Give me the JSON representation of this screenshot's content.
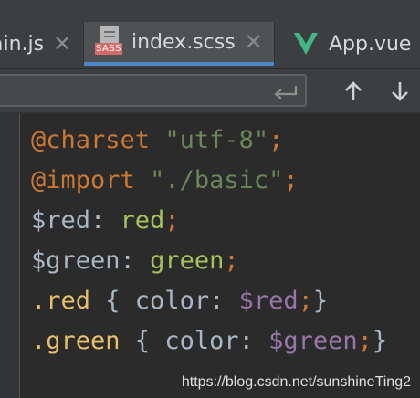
{
  "tabs": [
    {
      "label": "ain.js",
      "close": "✕",
      "active": false
    },
    {
      "label": "index.scss",
      "close": "✕",
      "active": true,
      "badge": "SASS"
    },
    {
      "label": "App.vue",
      "active": false
    }
  ],
  "search": {
    "value": "",
    "placeholder": ""
  },
  "navigation": {
    "prev_glyph": "↑",
    "next_glyph": "↓"
  },
  "code_lines": [
    [
      {
        "text": "@charset",
        "kind": "at"
      },
      {
        "text": " ",
        "kind": "plain"
      },
      {
        "text": "\"utf-8\"",
        "kind": "str"
      },
      {
        "text": ";",
        "kind": "punc"
      }
    ],
    [
      {
        "text": "@import",
        "kind": "at"
      },
      {
        "text": " ",
        "kind": "plain"
      },
      {
        "text": "\"./basic\"",
        "kind": "str"
      },
      {
        "text": ";",
        "kind": "punc"
      }
    ],
    [
      {
        "text": "$red",
        "kind": "var"
      },
      {
        "text": ": ",
        "kind": "plain"
      },
      {
        "text": "red",
        "kind": "val"
      },
      {
        "text": ";",
        "kind": "punc"
      }
    ],
    [
      {
        "text": "$green",
        "kind": "var"
      },
      {
        "text": ": ",
        "kind": "plain"
      },
      {
        "text": "green",
        "kind": "val"
      },
      {
        "text": ";",
        "kind": "punc"
      }
    ],
    [
      {
        "text": ".red",
        "kind": "sel"
      },
      {
        "text": " { color: ",
        "kind": "plain"
      },
      {
        "text": "$red",
        "kind": "varv"
      },
      {
        "text": ";",
        "kind": "punc"
      },
      {
        "text": "}",
        "kind": "plain"
      }
    ],
    [
      {
        "text": ".green",
        "kind": "sel"
      },
      {
        "text": " { color: ",
        "kind": "plain"
      },
      {
        "text": "$green",
        "kind": "varv"
      },
      {
        "text": ";",
        "kind": "punc"
      },
      {
        "text": "}",
        "kind": "plain"
      }
    ]
  ],
  "watermark": "https://blog.csdn.net/sunshineTing2",
  "colors": {
    "accent_underline": "#4a88c7",
    "vue_green": "#41b883",
    "sass_badge": "#d26c6c"
  }
}
